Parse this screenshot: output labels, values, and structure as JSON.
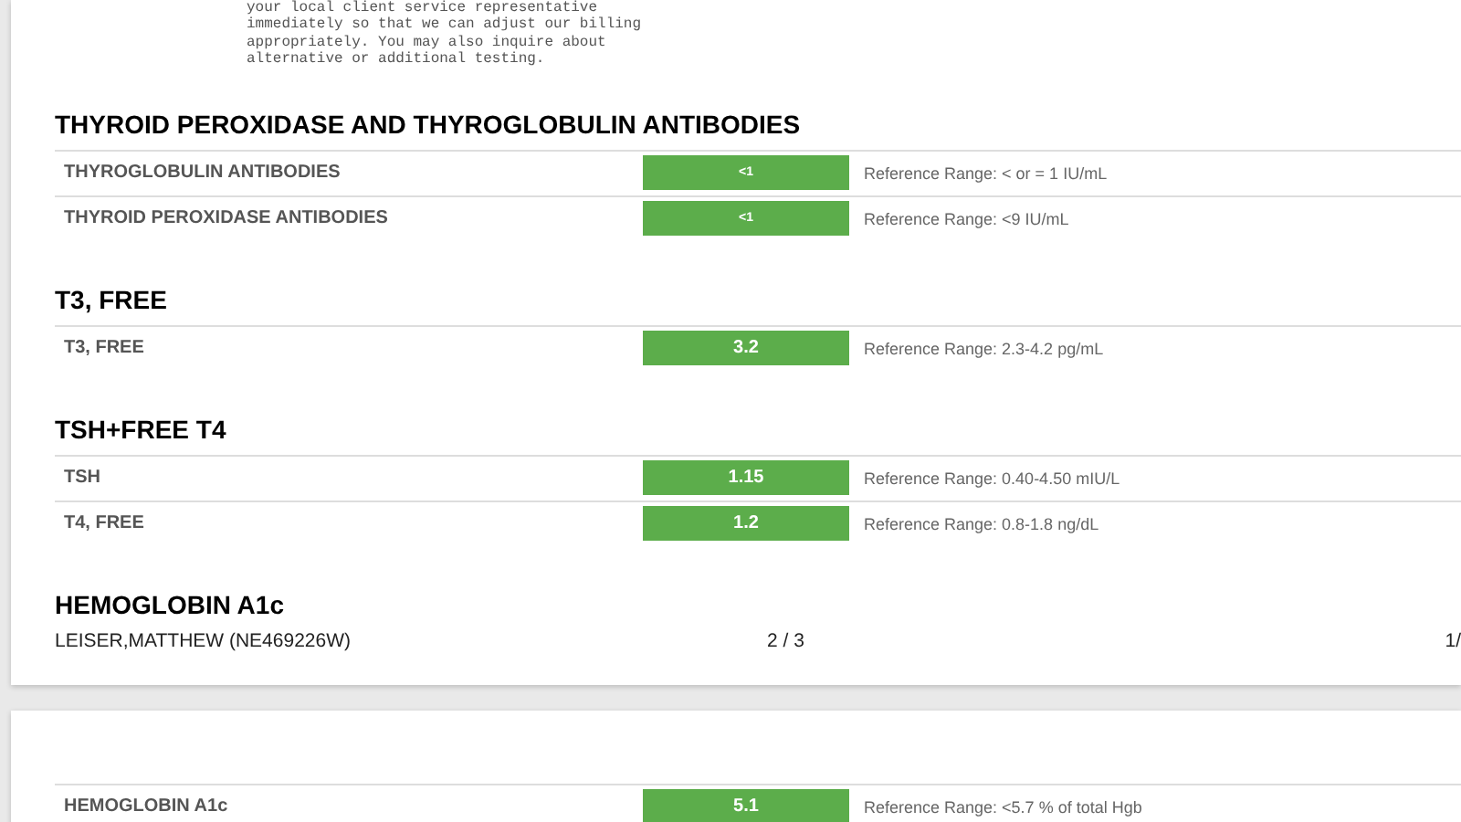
{
  "notice": [
    "your local client service representative",
    "immediately so that we can adjust our billing",
    "appropriately. You may also inquire about",
    "alternative or additional testing."
  ],
  "pages": [
    {
      "sections": [
        {
          "title": "THYROID PEROXIDASE AND THYROGLOBULIN ANTIBODIES",
          "rows": [
            {
              "test": "THYROGLOBULIN ANTIBODIES",
              "value": "<1",
              "range": "Reference Range: < or = 1 IU/mL"
            },
            {
              "test": "THYROID PEROXIDASE ANTIBODIES",
              "value": "<1",
              "range": "Reference Range: <9 IU/mL"
            }
          ]
        },
        {
          "title": "T3, FREE",
          "rows": [
            {
              "test": "T3, FREE",
              "value": "3.2",
              "range": "Reference Range: 2.3-4.2 pg/mL"
            }
          ]
        },
        {
          "title": "TSH+FREE T4",
          "rows": [
            {
              "test": "TSH",
              "value": "1.15",
              "range": "Reference Range: 0.40-4.50 mIU/L"
            },
            {
              "test": "T4, FREE",
              "value": "1.2",
              "range": "Reference Range: 0.8-1.8 ng/dL"
            }
          ]
        },
        {
          "title": "HEMOGLOBIN A1c"
        }
      ],
      "footer": {
        "patient": "LEISER,MATTHEW (NE469226W)",
        "page": "2 / 3",
        "right": "1/"
      }
    },
    {
      "sections": [
        {
          "rows": [
            {
              "test": "HEMOGLOBIN A1c",
              "value": "5.1",
              "range": "Reference Range: <5.7 % of total Hgb"
            }
          ]
        }
      ]
    }
  ]
}
